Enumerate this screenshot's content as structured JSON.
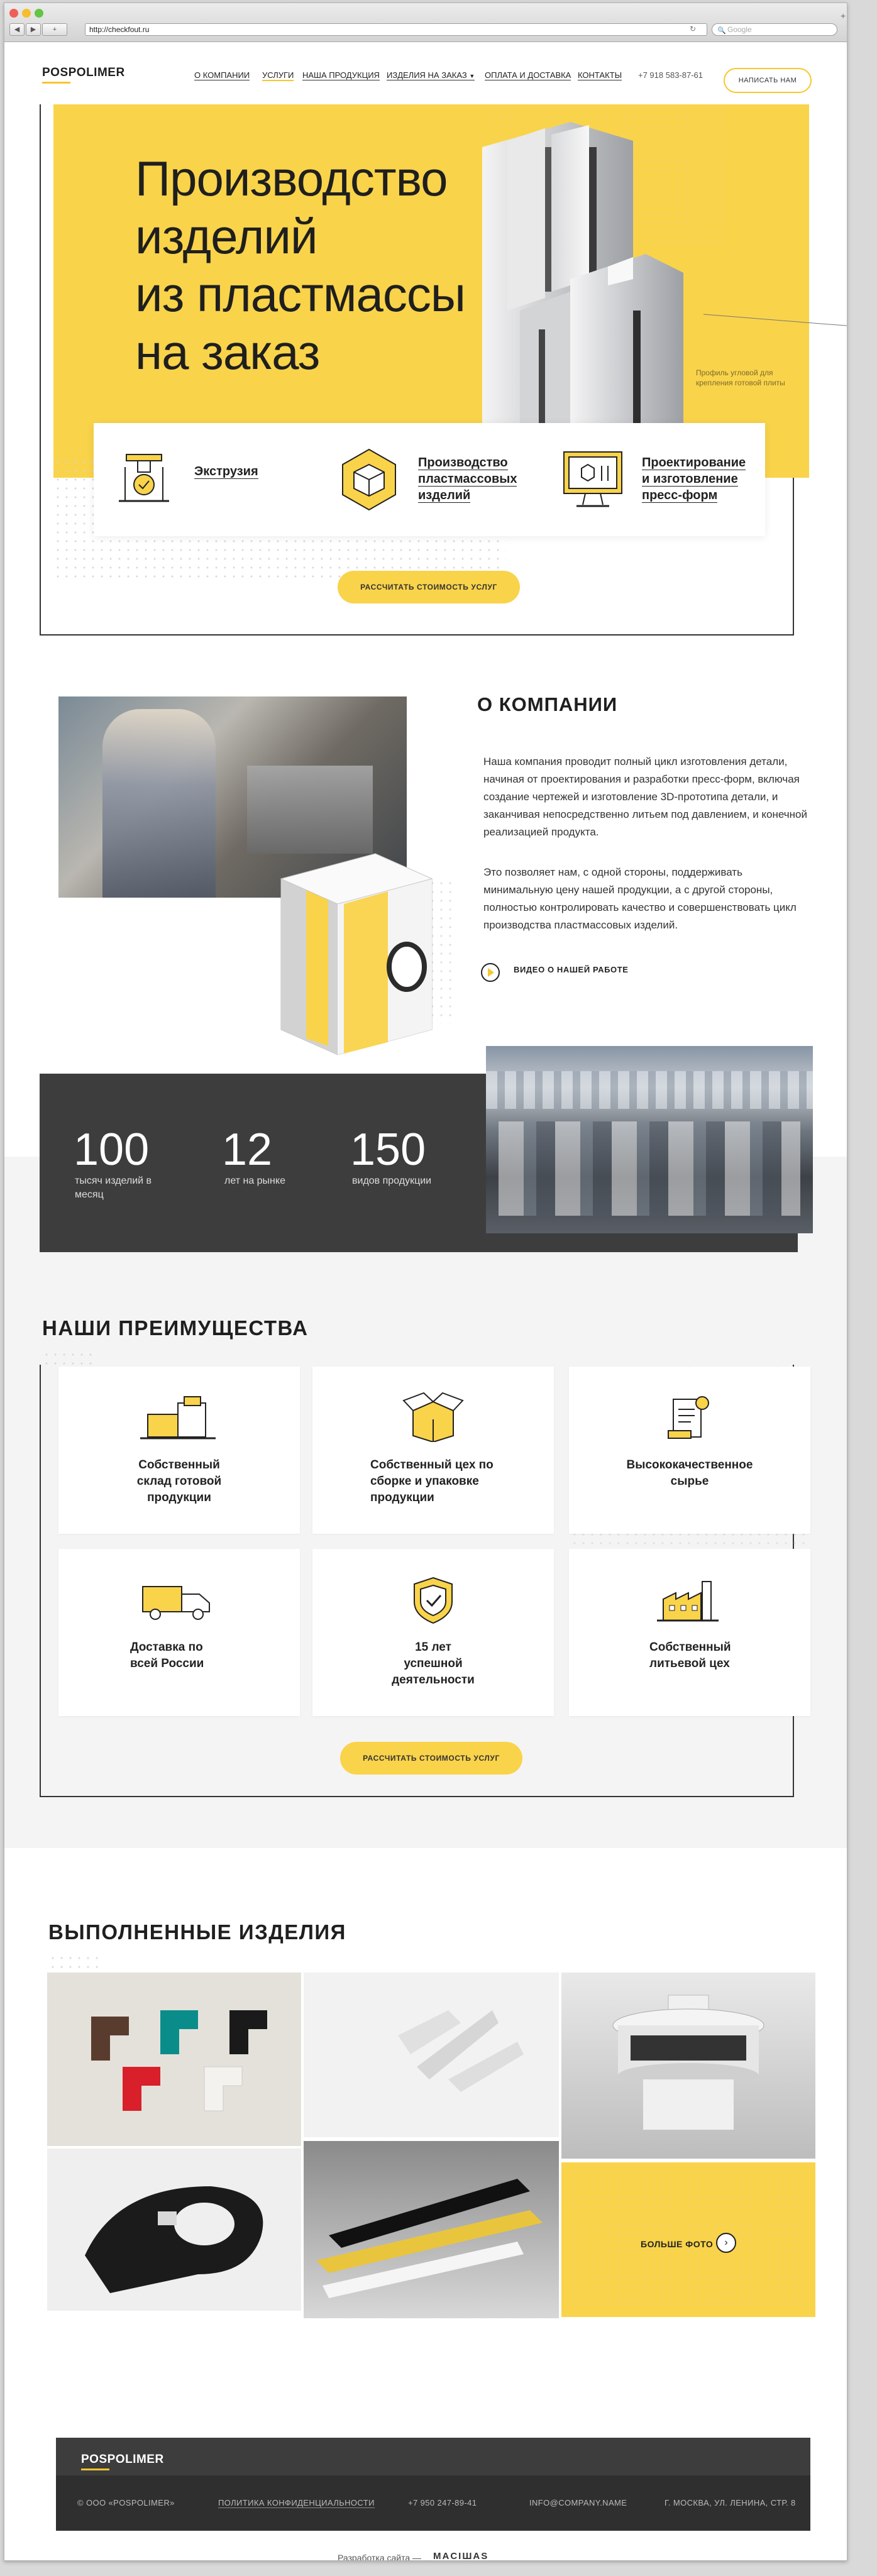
{
  "browser": {
    "url": "http://checkfout.ru",
    "search_placeholder": "Google",
    "back": "◀",
    "forward": "▶",
    "add": "+"
  },
  "header": {
    "logo": "POSPOLIMER",
    "nav": [
      "О КОМПАНИИ",
      "УСЛУГИ",
      "НАША ПРОДУКЦИЯ",
      "ИЗДЕЛИЯ НА ЗАКАЗ",
      "ОПЛАТА И ДОСТАВКА",
      "КОНТАКТЫ"
    ],
    "phone": "+7 918 583-87-61",
    "write_button": "НАПИСАТЬ НАМ"
  },
  "hero": {
    "title_lines": [
      "Производство",
      "изделий",
      "из пластмассы",
      "на заказ"
    ],
    "caption": "Профиль угловой для крепления готовой плиты",
    "services": [
      {
        "label": "Экструзия",
        "icon": "extrusion-icon"
      },
      {
        "label": "Производство пластмассовых изделий",
        "icon": "cube-icon"
      },
      {
        "label": "Проектирование и изготовление пресс-форм",
        "icon": "design-monitor-icon"
      }
    ],
    "cta": "РАССЧИТАТЬ СТОИМОСТЬ УСЛУГ"
  },
  "about": {
    "title": "О КОМПАНИИ",
    "p1": "Наша компания проводит полный цикл изготовления детали, начиная от проектирования и разработки пресс-форм, включая создание чертежей и изготовление 3D-прототипа детали, и заканчивая непосредственно литьем под давлением, и конечной реализацией продукта.",
    "p2": "Это позволяет нам, с одной стороны, поддерживать минимальную цену нашей продукции, а с другой стороны, полностью контролировать качество и совершенствовать цикл производства пластмассовых изделий.",
    "video_link": "ВИДЕО О НАШЕЙ РАБОТЕ"
  },
  "stats": [
    {
      "value": "100",
      "label": "тысяч изделий в месяц"
    },
    {
      "value": "12",
      "label": "лет на рынке"
    },
    {
      "value": "150",
      "label": "видов продукции"
    }
  ],
  "advantages": {
    "title": "НАШИ ПРЕИМУЩЕСТВА",
    "items": [
      {
        "label": "Собственный склад готовой продукции",
        "icon": "warehouse-boxes-icon"
      },
      {
        "label": "Собственный цех по сборке и упаковке продукции",
        "icon": "open-box-icon"
      },
      {
        "label": "Высококачественное сырье",
        "icon": "certificate-icon"
      },
      {
        "label": "Доставка по всей России",
        "icon": "truck-icon"
      },
      {
        "label": "15 лет успешной деятельности",
        "icon": "shield-check-icon"
      },
      {
        "label": "Собственный литьевой цех",
        "icon": "factory-icon"
      }
    ],
    "cta": "РАССЧИТАТЬ СТОИМОСТЬ УСЛУГ"
  },
  "products": {
    "title": "ВЫПОЛНЕННЫЕ ИЗДЕЛИЯ",
    "more": "БОЛЬШЕ ФОТО",
    "more_arrow": "›"
  },
  "footer": {
    "logo": "POSPOLIMER",
    "copyright": "© ООО «POSPOLIMER»",
    "privacy": "ПОЛИТИКА КОНФИДЕНЦИАЛЬНОСТИ",
    "phone": "+7 950 247-89-41",
    "email": "INFO@COMPANY.NAME",
    "address": "Г. МОСКВА, УЛ. ЛЕНИНА, СТР. 8",
    "dev_label": "Разработка сайта —",
    "dev_brand": "MACIШAS"
  },
  "colors": {
    "accent": "#f9d34a",
    "dark": "#3d3d3e"
  }
}
